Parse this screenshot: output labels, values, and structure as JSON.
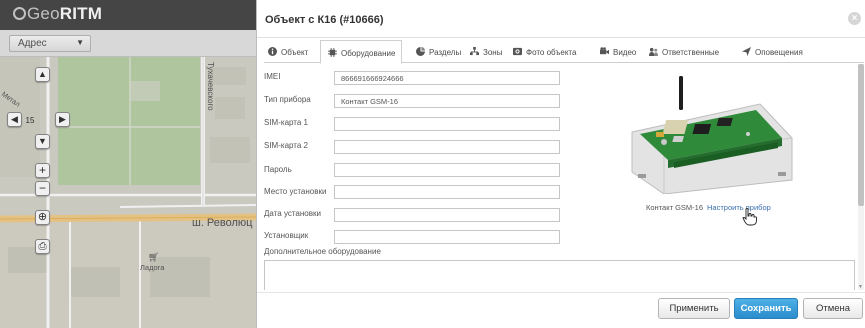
{
  "app": {
    "logo_prefix": "Geo",
    "logo_suffix": "RITM",
    "address_select": "Адрес"
  },
  "map": {
    "zoom_level": "15",
    "street_vertical": "Тухачевского",
    "street_main": "ш. Революц",
    "place_label": "Ладога",
    "corner_label": "Метал"
  },
  "dialog": {
    "title": "Объект с К16 (#10666)",
    "close_icon": "close-icon",
    "tabs": [
      {
        "label": "Объект",
        "icon": "info-icon"
      },
      {
        "label": "Оборудование",
        "icon": "chip-icon"
      },
      {
        "label": "Разделы",
        "icon": "pie-icon"
      },
      {
        "label": "Зоны",
        "icon": "zones-icon"
      },
      {
        "label": "Фото объекта",
        "icon": "camera-icon"
      },
      {
        "label": "Видео",
        "icon": "video-icon"
      },
      {
        "label": "Ответственные",
        "icon": "users-icon"
      },
      {
        "label": "Оповещения",
        "icon": "send-icon"
      }
    ],
    "active_tab": "Оборудование",
    "fields": [
      {
        "label": "IMEI",
        "value": "866691666924666"
      },
      {
        "label": "Тип прибора",
        "value": "Контакт GSM-16"
      },
      {
        "label": "SIM-карта 1",
        "value": ""
      },
      {
        "label": "SIM-карта 2",
        "value": ""
      },
      {
        "label": "Пароль",
        "value": ""
      },
      {
        "label": "Место установки",
        "value": ""
      },
      {
        "label": "Дата установки",
        "value": ""
      },
      {
        "label": "Установщик",
        "value": ""
      }
    ],
    "extra_label": "Дополнительное оборудование",
    "extra_value": "",
    "device_caption": "Контакт GSM-16",
    "device_link": "Настроить прибор",
    "buttons": {
      "apply": "Применить",
      "save": "Сохранить",
      "cancel": "Отмена"
    },
    "colors": {
      "save_button": "#2a8ccb",
      "link": "#3a6fb0",
      "board_green": "#2f8a3a"
    }
  }
}
